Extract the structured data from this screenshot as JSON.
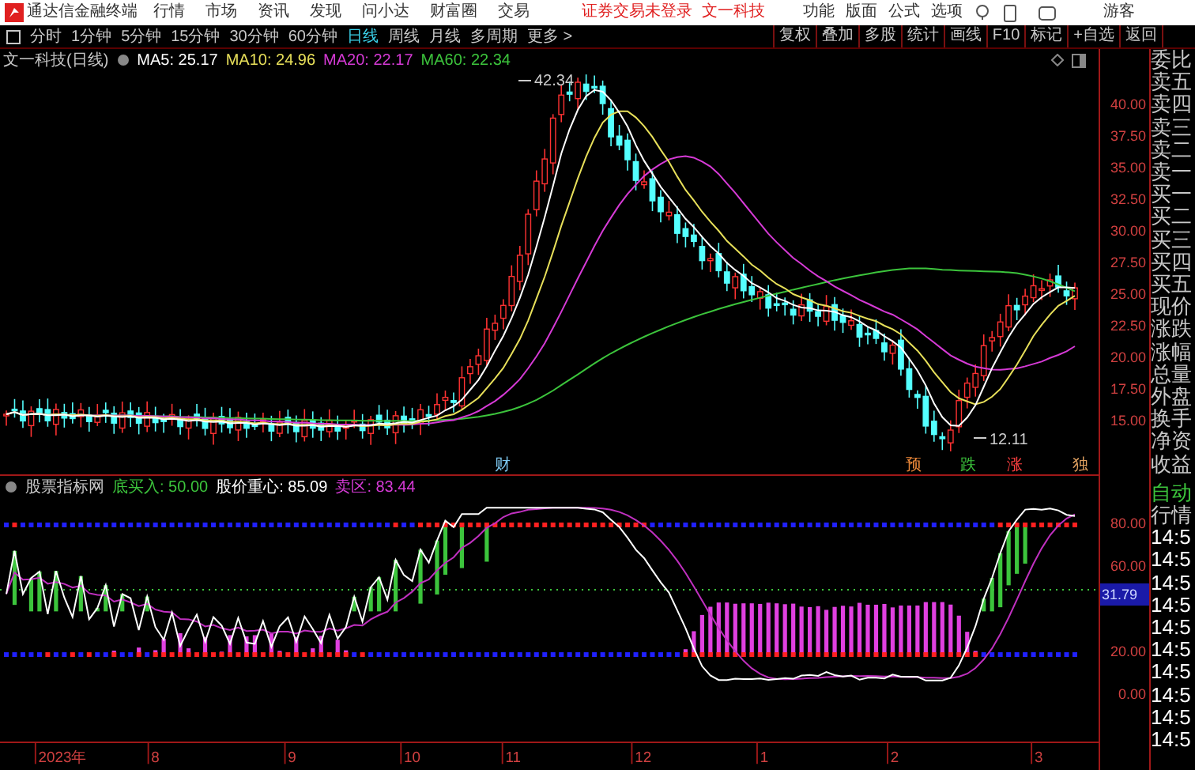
{
  "app_title": "通达信金融终端",
  "menu": [
    "行情",
    "市场",
    "资讯",
    "发现",
    "问小达",
    "财富圈",
    "交易"
  ],
  "login_notice": "证券交易未登录",
  "stock_name": "文一科技",
  "user_menu": [
    "功能",
    "版面",
    "公式",
    "选项"
  ],
  "user": "游客",
  "periods": [
    {
      "label": "分时",
      "selected": false
    },
    {
      "label": "1分钟",
      "selected": false
    },
    {
      "label": "5分钟",
      "selected": false
    },
    {
      "label": "15分钟",
      "selected": false
    },
    {
      "label": "30分钟",
      "selected": false
    },
    {
      "label": "60分钟",
      "selected": false
    },
    {
      "label": "日线",
      "selected": true
    },
    {
      "label": "周线",
      "selected": false
    },
    {
      "label": "月线",
      "selected": false
    },
    {
      "label": "多周期",
      "selected": false
    },
    {
      "label": "更多 >",
      "selected": false
    }
  ],
  "tools": [
    "复权",
    "叠加",
    "多股",
    "统计",
    "画线",
    "F10",
    "标记",
    "+自选",
    "返回"
  ],
  "legend": {
    "title": "文一科技(日线)",
    "items": [
      {
        "label": "MA5: 25.17",
        "color": "#ffffff"
      },
      {
        "label": "MA10: 24.96",
        "color": "#e8e05a"
      },
      {
        "label": "MA20: 22.17",
        "color": "#d63ad6"
      },
      {
        "label": "MA60: 22.34",
        "color": "#3cc43c"
      }
    ]
  },
  "main_chart": {
    "high_label": "42.34",
    "low_label": "12.11",
    "yaxis": [
      "40.00",
      "37.50",
      "35.00",
      "32.50",
      "30.00",
      "27.50",
      "25.00",
      "22.50",
      "20.00",
      "17.50",
      "15.00"
    ],
    "markers": [
      {
        "text": "财",
        "color": "#7ec8f0"
      },
      {
        "text": "预",
        "color": "#f08a3a"
      },
      {
        "text": "跌",
        "color": "#3cc43c"
      },
      {
        "text": "涨",
        "color": "#ff4040"
      },
      {
        "text": "独",
        "color": "#e0a060"
      }
    ]
  },
  "indicator": {
    "name": "股票指标网",
    "items": [
      {
        "label": "底买入: 50.00",
        "color": "#3cc43c"
      },
      {
        "label": "股价重心: 85.09",
        "color": "#ffffff"
      },
      {
        "label": "卖区: 83.44",
        "color": "#d63ad6"
      }
    ],
    "yaxis": [
      "80.00",
      "60.00",
      "20.00",
      "0.00"
    ],
    "current": "31.79"
  },
  "time_axis": [
    "2023年",
    "8",
    "9",
    "10",
    "11",
    "12",
    "1",
    "2",
    "3"
  ],
  "quote_panel": {
    "labels": [
      "委比",
      "卖五",
      "卖四",
      "卖三",
      "卖二",
      "卖一",
      "买一",
      "买二",
      "买三",
      "买四",
      "买五",
      "现价",
      "涨跌",
      "涨幅",
      "总量",
      "外盘",
      "换手",
      "净资",
      "收益"
    ],
    "auto": "自动",
    "quotes": "行情",
    "times": [
      "14:5",
      "14:5",
      "14:5",
      "14:5",
      "14:5",
      "14:5",
      "14:5",
      "14:5",
      "14:5",
      "14:5"
    ]
  }
}
